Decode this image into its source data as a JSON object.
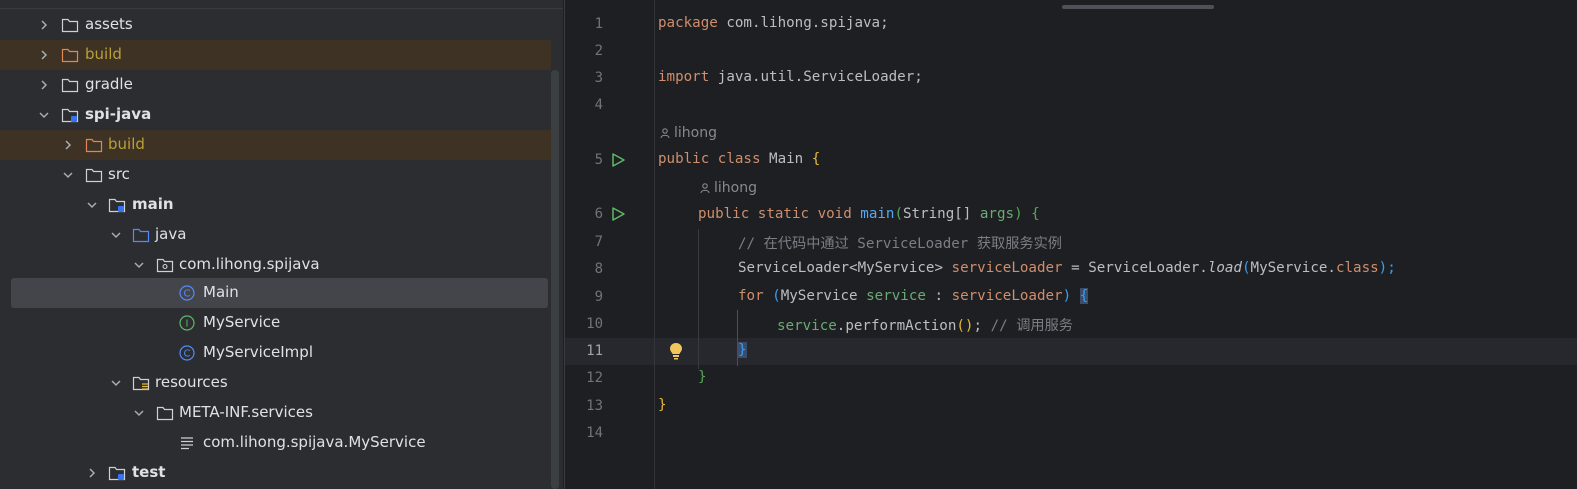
{
  "tree": {
    "items": [
      {
        "label": "assets",
        "expanded": false,
        "icon": "folder-icon"
      },
      {
        "label": "build",
        "expanded": false,
        "icon": "excluded-folder-icon",
        "excluded": true
      },
      {
        "label": "gradle",
        "expanded": false,
        "icon": "folder-icon"
      },
      {
        "label": "spi-java",
        "expanded": true,
        "icon": "module-folder-icon"
      },
      {
        "label": "build",
        "expanded": false,
        "icon": "excluded-folder-icon",
        "excluded": true
      },
      {
        "label": "src",
        "expanded": true,
        "icon": "folder-icon"
      },
      {
        "label": "main",
        "expanded": true,
        "icon": "source-root-folder-icon"
      },
      {
        "label": "java",
        "expanded": true,
        "icon": "sources-folder-icon"
      },
      {
        "label": "com.lihong.spijava",
        "expanded": true,
        "icon": "package-icon"
      },
      {
        "label": "Main",
        "icon": "class-icon",
        "selected": true
      },
      {
        "label": "MyService",
        "icon": "interface-icon"
      },
      {
        "label": "MyServiceImpl",
        "icon": "class-icon"
      },
      {
        "label": "resources",
        "expanded": true,
        "icon": "resources-folder-icon"
      },
      {
        "label": "META-INF.services",
        "expanded": true,
        "icon": "folder-icon"
      },
      {
        "label": "com.lihong.spijava.MyService",
        "icon": "text-file-icon"
      },
      {
        "label": "test",
        "expanded": false,
        "icon": "source-root-folder-icon"
      }
    ]
  },
  "editor": {
    "line_numbers": [
      "1",
      "2",
      "3",
      "4",
      "5",
      "6",
      "7",
      "8",
      "9",
      "10",
      "11",
      "12",
      "13",
      "14"
    ],
    "current_line": "11",
    "author_hint": "lihong",
    "code": {
      "l1": {
        "kw": "package",
        "rest": " com.lihong.spijava;"
      },
      "l3": {
        "kw": "import",
        "rest": " java.util.ServiceLoader;"
      },
      "l5": {
        "kw": "public class",
        "name": " Main ",
        "brace": "{"
      },
      "l6": {
        "kw": "public static void",
        "fn": "main",
        "open": "(",
        "type": "String[] ",
        "param": "args",
        "close": ")",
        "brace": "{"
      },
      "l7": {
        "comment": "// 在代码中通过 ServiceLoader 获取服务实例"
      },
      "l8": {
        "type": "ServiceLoader<MyService> ",
        "var": "serviceLoader",
        "eq": " = ServiceLoader.",
        "method": "load",
        "open": "(",
        "arg": "MyService.",
        "kw": "class",
        "close": ");"
      },
      "l9": {
        "kw": "for",
        "open": " (",
        "type": "MyService ",
        "var": "service",
        "colon": " : ",
        "iter": "serviceLoader",
        "close": ") ",
        "brace": "{"
      },
      "l10": {
        "var": "service",
        "call": ".performAction",
        "parens": "()",
        "semi": "; ",
        "comment": "// 调用服务"
      },
      "l11": {
        "brace": "}"
      },
      "l12": {
        "brace": "}"
      },
      "l13": {
        "brace": "}"
      }
    }
  }
}
